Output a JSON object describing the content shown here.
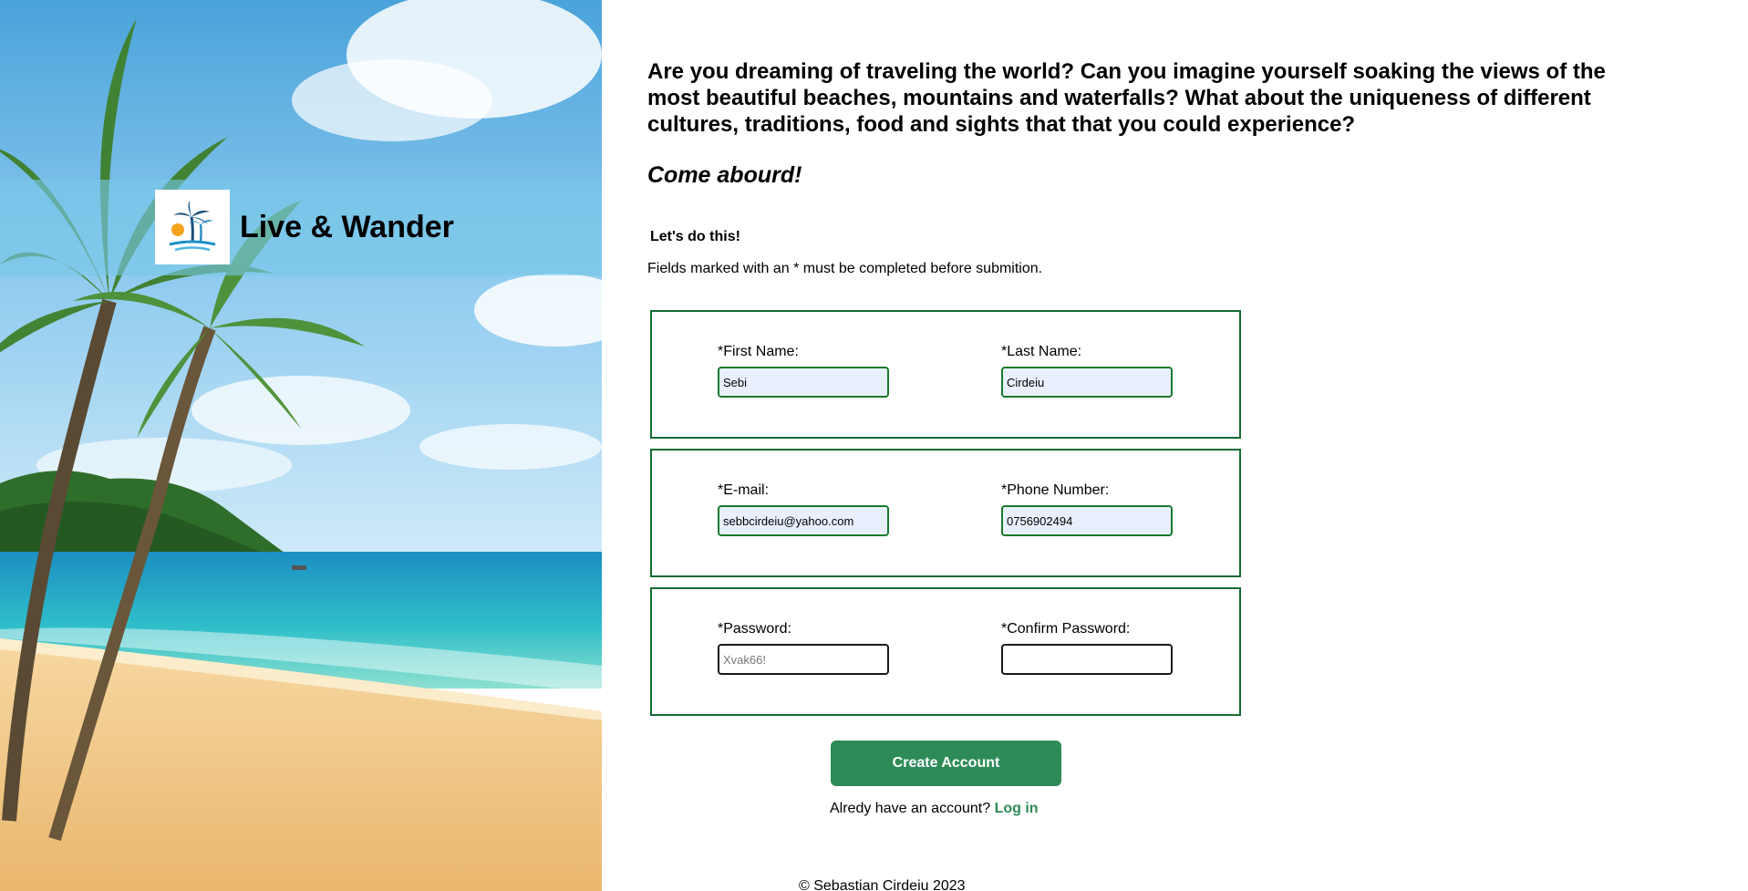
{
  "brand": {
    "name": "Live & Wander",
    "logo_icon": "palm-tree-sunset-logo"
  },
  "intro": {
    "text": "Are you dreaming of traveling the world? Can you imagine yourself soaking the views of the most beautiful beaches, mountains and waterfalls? What about the uniqueness of different cultures, traditions, food and sights that that you could experience?",
    "tagline": "Come abourd!"
  },
  "form": {
    "title": "Let's do this!",
    "note": "Fields marked with an * must be completed before submition.",
    "first_name": {
      "label": "*First Name:",
      "value": "Sebi"
    },
    "last_name": {
      "label": "*Last Name:",
      "value": "Cirdeiu"
    },
    "email": {
      "label": "*E-mail:",
      "value": "sebbcirdeiu@yahoo.com"
    },
    "phone": {
      "label": "*Phone Number:",
      "value": "0756902494"
    },
    "password": {
      "label": "*Password:",
      "value": "",
      "placeholder": "Xvak66!"
    },
    "confirm_password": {
      "label": "*Confirm Password:",
      "value": ""
    },
    "submit_label": "Create Account",
    "login_prompt": "Alredy have an account?",
    "login_link": "Log in"
  },
  "footer": {
    "copyright": "© Sebastian Cirdeiu 2023"
  },
  "colors": {
    "accent_green": "#2e8b57",
    "border_green": "#176b34",
    "autofill_bg": "#e8f0fe",
    "brand_band": "#78c8e8"
  }
}
